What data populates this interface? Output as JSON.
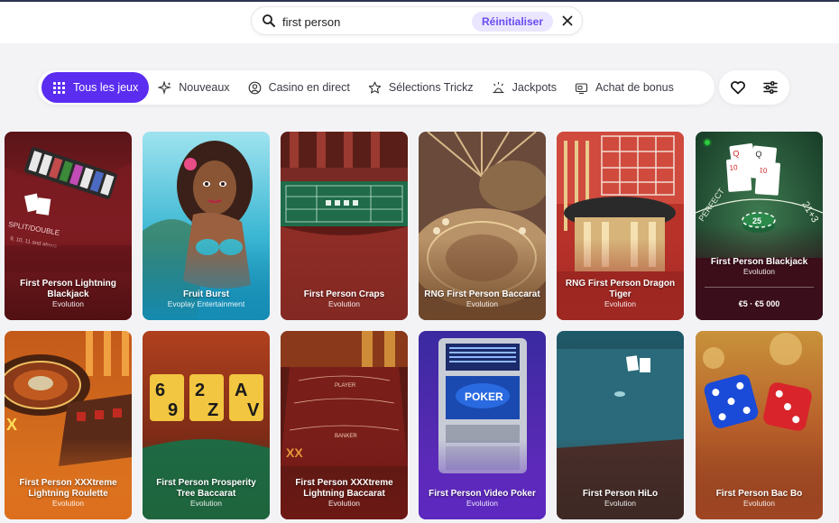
{
  "search": {
    "value": "first person",
    "reset_label": "Réinitialiser"
  },
  "categories": [
    {
      "label": "Tous les jeux",
      "icon": "grid-icon",
      "active": true
    },
    {
      "label": "Nouveaux",
      "icon": "sparkle-icon"
    },
    {
      "label": "Casino en direct",
      "icon": "dealer-icon"
    },
    {
      "label": "Sélections Trickz",
      "icon": "star-icon"
    },
    {
      "label": "Jackpots",
      "icon": "jackpot-icon"
    },
    {
      "label": "Achat de bonus",
      "icon": "bonus-icon"
    }
  ],
  "actions": {
    "favorites_icon": "heart-icon",
    "filters_icon": "sliders-icon"
  },
  "accent_color": "#5b2df0",
  "games": [
    {
      "title": "First Person Lightning Blackjack",
      "provider": "Evolution"
    },
    {
      "title": "Fruit Burst",
      "provider": "Evoplay Entertainment"
    },
    {
      "title": "First Person Craps",
      "provider": "Evolution"
    },
    {
      "title": "RNG First Person Baccarat",
      "provider": "Evolution"
    },
    {
      "title": "RNG First Person Dragon Tiger",
      "provider": "Evolution"
    },
    {
      "title": "First Person Blackjack",
      "provider": "Evolution",
      "limits": "€5 · €5 000",
      "live": true
    },
    {
      "title": "First Person XXXtreme Lightning Roulette",
      "provider": "Evolution"
    },
    {
      "title": "First Person Prosperity Tree Baccarat",
      "provider": "Evolution"
    },
    {
      "title": "First Person XXXtreme Lightning Baccarat",
      "provider": "Evolution"
    },
    {
      "title": "First Person Video Poker",
      "provider": "Evolution"
    },
    {
      "title": "First Person HiLo",
      "provider": "Evolution"
    },
    {
      "title": "First Person Bac Bo",
      "provider": "Evolution"
    }
  ]
}
